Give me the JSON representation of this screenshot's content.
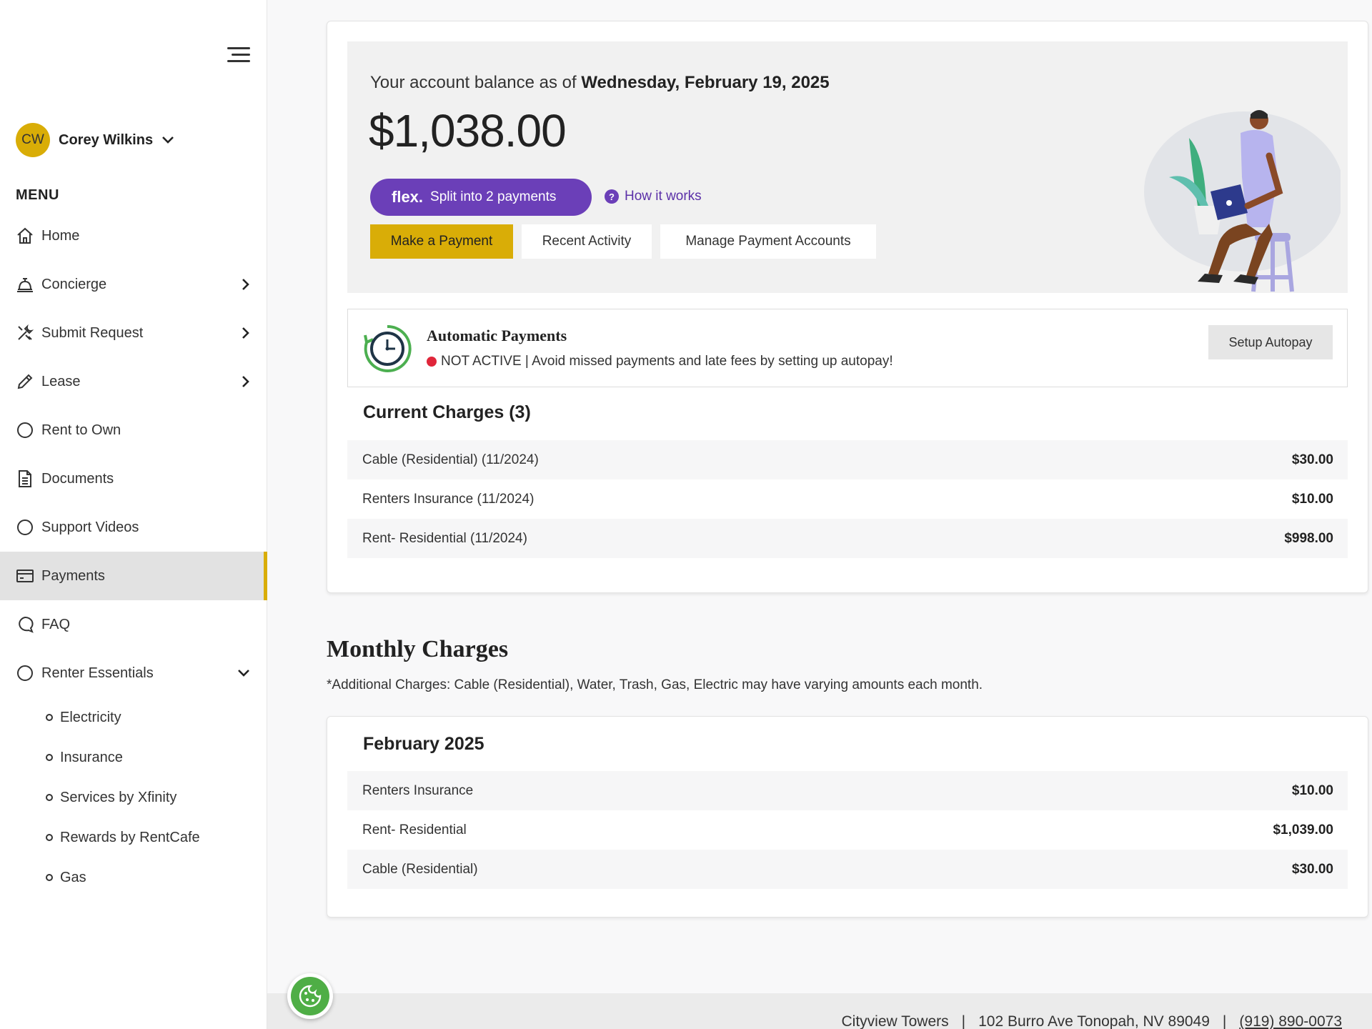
{
  "user": {
    "initials": "CW",
    "name": "Corey Wilkins"
  },
  "menu": {
    "title": "MENU",
    "items": [
      {
        "label": "Home",
        "icon": "home-icon"
      },
      {
        "label": "Concierge",
        "icon": "bell-icon"
      },
      {
        "label": "Submit Request",
        "icon": "tools-icon"
      },
      {
        "label": "Lease",
        "icon": "pencil-icon"
      },
      {
        "label": "Rent to Own",
        "icon": "circle-icon"
      },
      {
        "label": "Documents",
        "icon": "document-icon"
      },
      {
        "label": "Support Videos",
        "icon": "circle-icon"
      },
      {
        "label": "Payments",
        "icon": "credit-card-icon"
      },
      {
        "label": "FAQ",
        "icon": "chat-icon"
      },
      {
        "label": "Renter Essentials",
        "icon": "circle-icon"
      }
    ],
    "sub_items": [
      "Electricity",
      "Insurance",
      "Services by Xfinity",
      "Rewards by RentCafe",
      "Gas"
    ]
  },
  "balance": {
    "prefix": "Your account balance as of ",
    "date": "Wednesday, February 19, 2025",
    "amount": "$1,038.00"
  },
  "flex": {
    "logo": "flex.",
    "label": "Split into 2 payments",
    "how": "How it works"
  },
  "actions": {
    "pay": "Make a Payment",
    "activity": "Recent Activity",
    "manage": "Manage Payment Accounts"
  },
  "autopay": {
    "title": "Automatic Payments",
    "status": "NOT ACTIVE | Avoid missed payments and late fees by setting up autopay!",
    "button": "Setup Autopay"
  },
  "current": {
    "title": "Current Charges (3)",
    "rows": [
      {
        "label": "Cable (Residential) (11/2024)",
        "amount": "$30.00"
      },
      {
        "label": "Renters Insurance (11/2024)",
        "amount": "$10.00"
      },
      {
        "label": "Rent- Residential (11/2024)",
        "amount": "$998.00"
      }
    ]
  },
  "monthly": {
    "title": "Monthly Charges",
    "note": "*Additional Charges: Cable (Residential), Water, Trash, Gas, Electric may have varying amounts each month.",
    "month": "February 2025",
    "rows": [
      {
        "label": "Renters Insurance",
        "amount": "$10.00"
      },
      {
        "label": "Rent- Residential",
        "amount": "$1,039.00"
      },
      {
        "label": "Cable (Residential)",
        "amount": "$30.00"
      }
    ]
  },
  "footer": {
    "property": "Cityview Towers",
    "address": "102 Burro Ave Tonopah, NV 89049",
    "phone": "(919) 890-0073",
    "sep": "|"
  },
  "colors": {
    "accent": "#d9ad07",
    "flex": "#6b3fb8",
    "status": "#e0263a",
    "cookie": "#4fae46"
  }
}
